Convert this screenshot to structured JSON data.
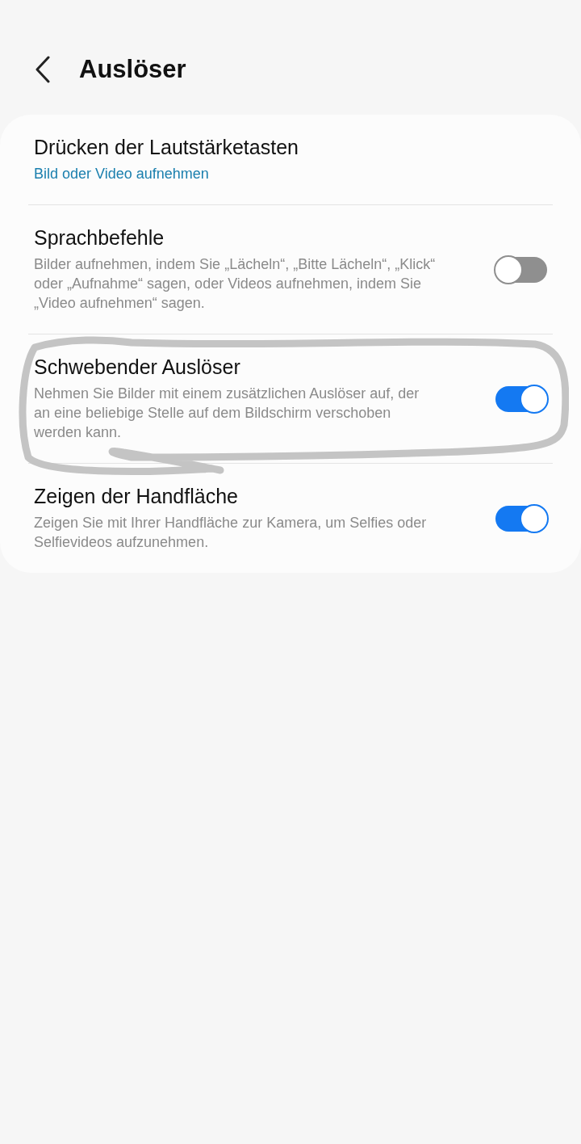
{
  "header": {
    "title": "Auslöser"
  },
  "items": [
    {
      "kind": "link",
      "title": "Drücken der Lautstärketasten",
      "subtitle": "Bild oder Video aufnehmen",
      "circled": false
    },
    {
      "kind": "toggle",
      "title": "Sprachbefehle",
      "subtitle": "Bilder aufnehmen, indem Sie „Lächeln“, „Bitte Lächeln“, „Klick“ oder „Aufnahme“ sagen, oder Videos aufnehmen, indem Sie „Video aufnehmen“ sagen.",
      "on": false,
      "circled": false
    },
    {
      "kind": "toggle",
      "title": "Schwebender Auslöser",
      "subtitle": "Nehmen Sie Bilder mit einem zusätzlichen Auslöser auf, der an eine beliebige Stelle auf dem Bildschirm verschoben werden kann.",
      "on": true,
      "circled": true
    },
    {
      "kind": "toggle",
      "title": "Zeigen der Handfläche",
      "subtitle": "Zeigen Sie mit Ihrer Handfläche zur Kamera, um Selfies oder Selfievideos aufzunehmen.",
      "on": true,
      "circled": false
    }
  ]
}
